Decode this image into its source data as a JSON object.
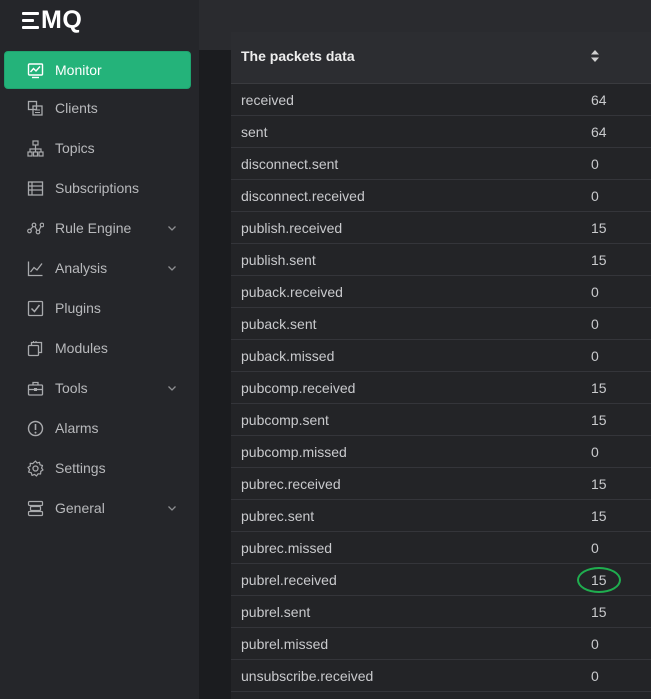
{
  "app": {
    "logo_text": "MQ"
  },
  "sidebar": {
    "items": [
      {
        "label": "Monitor",
        "icon": "monitor-icon",
        "active": true,
        "chevron": false
      },
      {
        "label": "Clients",
        "icon": "clients-icon",
        "active": false,
        "chevron": false
      },
      {
        "label": "Topics",
        "icon": "topics-icon",
        "active": false,
        "chevron": false
      },
      {
        "label": "Subscriptions",
        "icon": "subscriptions-icon",
        "active": false,
        "chevron": false
      },
      {
        "label": "Rule Engine",
        "icon": "rule-engine-icon",
        "active": false,
        "chevron": true
      },
      {
        "label": "Analysis",
        "icon": "analysis-icon",
        "active": false,
        "chevron": true
      },
      {
        "label": "Plugins",
        "icon": "plugins-icon",
        "active": false,
        "chevron": false
      },
      {
        "label": "Modules",
        "icon": "modules-icon",
        "active": false,
        "chevron": false
      },
      {
        "label": "Tools",
        "icon": "tools-icon",
        "active": false,
        "chevron": true
      },
      {
        "label": "Alarms",
        "icon": "alarms-icon",
        "active": false,
        "chevron": false
      },
      {
        "label": "Settings",
        "icon": "settings-icon",
        "active": false,
        "chevron": false
      },
      {
        "label": "General",
        "icon": "general-icon",
        "active": false,
        "chevron": true
      }
    ]
  },
  "table": {
    "header": "The packets data",
    "rows": [
      {
        "key": "received",
        "value": "64"
      },
      {
        "key": "sent",
        "value": "64"
      },
      {
        "key": "disconnect.sent",
        "value": "0"
      },
      {
        "key": "disconnect.received",
        "value": "0"
      },
      {
        "key": "publish.received",
        "value": "15"
      },
      {
        "key": "publish.sent",
        "value": "15"
      },
      {
        "key": "puback.received",
        "value": "0"
      },
      {
        "key": "puback.sent",
        "value": "0"
      },
      {
        "key": "puback.missed",
        "value": "0"
      },
      {
        "key": "pubcomp.received",
        "value": "15"
      },
      {
        "key": "pubcomp.sent",
        "value": "15"
      },
      {
        "key": "pubcomp.missed",
        "value": "0"
      },
      {
        "key": "pubrec.received",
        "value": "15"
      },
      {
        "key": "pubrec.sent",
        "value": "15"
      },
      {
        "key": "pubrec.missed",
        "value": "0"
      },
      {
        "key": "pubrel.received",
        "value": "15",
        "circled": true
      },
      {
        "key": "pubrel.sent",
        "value": "15"
      },
      {
        "key": "pubrel.missed",
        "value": "0"
      },
      {
        "key": "unsubscribe.received",
        "value": "0"
      }
    ]
  },
  "colors": {
    "accent": "#24b37a",
    "sidebar_bg": "#25262a",
    "annotation_ring": "#1fae4f"
  }
}
